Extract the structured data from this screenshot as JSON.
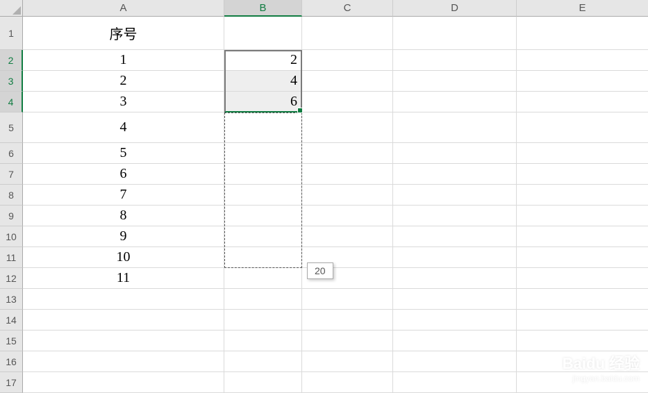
{
  "columns": [
    "A",
    "B",
    "C",
    "D",
    "E"
  ],
  "row_labels": [
    "1",
    "2",
    "3",
    "4",
    "5",
    "6",
    "7",
    "8",
    "9",
    "10",
    "11",
    "12",
    "13",
    "14",
    "15",
    "16",
    "17"
  ],
  "selected_col": "B",
  "selected_rows": [
    "2",
    "3",
    "4"
  ],
  "cells": {
    "A1": "序号",
    "A2": "1",
    "A3": "2",
    "A4": "3",
    "A5": "4",
    "A6": "5",
    "A7": "6",
    "A8": "7",
    "A9": "8",
    "A10": "9",
    "A11": "10",
    "A12": "11",
    "B2": "2",
    "B3": "4",
    "B4": "6"
  },
  "drag_tooltip": "20",
  "watermark": {
    "brand": "Baidu 经验",
    "url": "jingyan.baidu.com"
  },
  "chart_data": {
    "type": "table",
    "title": "序号",
    "columns": [
      "A (序号)",
      "B"
    ],
    "rows": [
      [
        "1",
        "2"
      ],
      [
        "2",
        "4"
      ],
      [
        "3",
        "6"
      ],
      [
        "4",
        ""
      ],
      [
        "5",
        ""
      ],
      [
        "6",
        ""
      ],
      [
        "7",
        ""
      ],
      [
        "8",
        ""
      ],
      [
        "9",
        ""
      ],
      [
        "10",
        ""
      ],
      [
        "11",
        ""
      ]
    ],
    "fill_preview_value": 20,
    "fill_target_range": "B5:B11",
    "source_range": "B2:B4"
  }
}
